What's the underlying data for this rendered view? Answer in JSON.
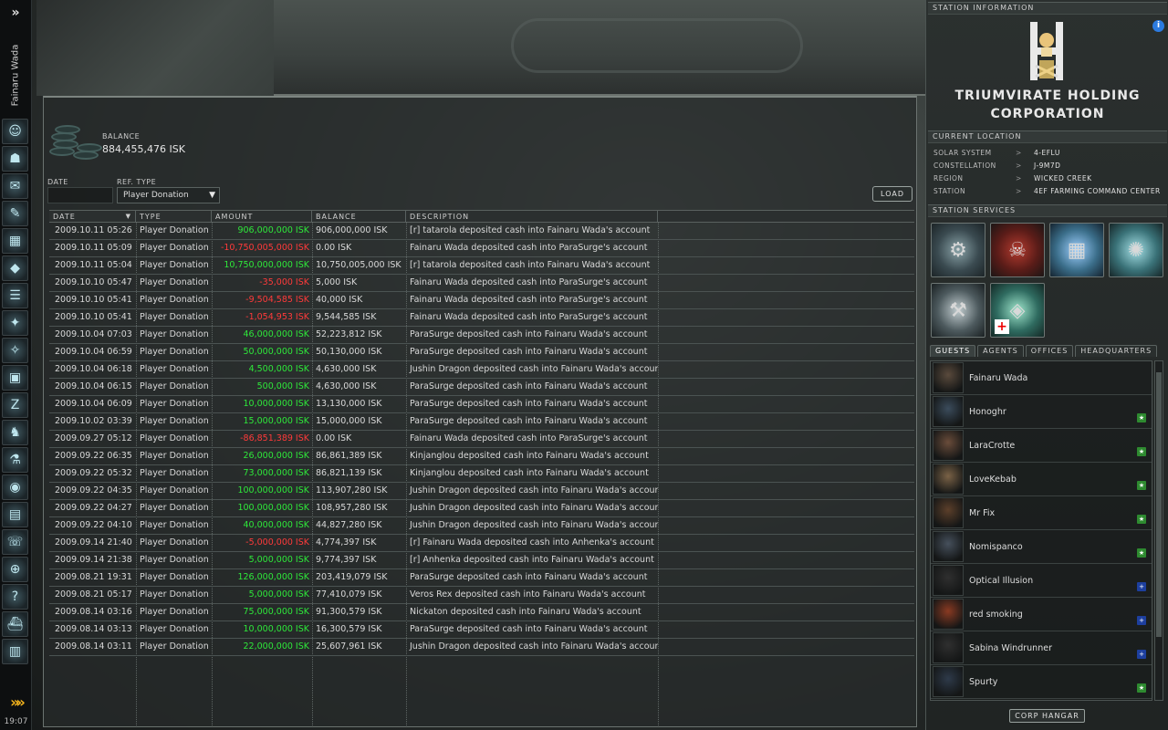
{
  "neocom": {
    "toggle": "»",
    "character_name": "Fainaru Wada",
    "icons": [
      "character-sheet-icon",
      "people-places-icon",
      "mail-icon",
      "notepad-icon",
      "assets-icon",
      "wallet-icon",
      "journal-icon",
      "map-icon",
      "starmap-icon",
      "market-icon",
      "skills-icon",
      "fitting-icon",
      "science-icon",
      "corporation-icon",
      "contracts-icon",
      "chat-icon",
      "browser-icon",
      "help-icon",
      "ship-hangar-icon",
      "item-hangar-icon"
    ],
    "glyphs": [
      "☺",
      "☗",
      "✉",
      "✎",
      "▦",
      "◆",
      "☰",
      "✦",
      "✧",
      "▣",
      "Z",
      "♞",
      "⚗",
      "◉",
      "▤",
      "☏",
      "⊕",
      "?",
      "⛴",
      "▥"
    ],
    "arrows": "»»",
    "clock": "19:07"
  },
  "wallet": {
    "balance_label": "BALANCE",
    "balance_value": "884,455,476 ISK",
    "date_label": "DATE",
    "ref_type_label": "REF. TYPE",
    "ref_type_value": "Player Donation",
    "load_label": "LOAD",
    "columns": [
      "DATE",
      "TYPE",
      "AMOUNT",
      "BALANCE",
      "DESCRIPTION"
    ],
    "rows": [
      {
        "date": "2009.10.11 05:26",
        "type": "Player Donation",
        "amount": "906,000,000 ISK",
        "sign": "pos",
        "balance": "906,000,000 ISK",
        "desc": "[r] tatarola deposited cash into Fainaru Wada's account"
      },
      {
        "date": "2009.10.11 05:09",
        "type": "Player Donation",
        "amount": "-10,750,005,000 ISK",
        "sign": "neg",
        "balance": "0.00 ISK",
        "desc": "Fainaru Wada deposited cash into ParaSurge's account"
      },
      {
        "date": "2009.10.11 05:04",
        "type": "Player Donation",
        "amount": "10,750,000,000 ISK",
        "sign": "pos",
        "balance": "10,750,005,000 ISK",
        "desc": "[r] tatarola deposited cash into Fainaru Wada's account"
      },
      {
        "date": "2009.10.10 05:47",
        "type": "Player Donation",
        "amount": "-35,000 ISK",
        "sign": "neg",
        "balance": "5,000 ISK",
        "desc": "Fainaru Wada deposited cash into ParaSurge's account"
      },
      {
        "date": "2009.10.10 05:41",
        "type": "Player Donation",
        "amount": "-9,504,585 ISK",
        "sign": "neg",
        "balance": "40,000 ISK",
        "desc": "Fainaru Wada deposited cash into ParaSurge's account"
      },
      {
        "date": "2009.10.10 05:41",
        "type": "Player Donation",
        "amount": "-1,054,953 ISK",
        "sign": "neg",
        "balance": "9,544,585 ISK",
        "desc": "Fainaru Wada deposited cash into ParaSurge's account"
      },
      {
        "date": "2009.10.04 07:03",
        "type": "Player Donation",
        "amount": "46,000,000 ISK",
        "sign": "pos",
        "balance": "52,223,812 ISK",
        "desc": "ParaSurge deposited cash into Fainaru Wada's account"
      },
      {
        "date": "2009.10.04 06:59",
        "type": "Player Donation",
        "amount": "50,000,000 ISK",
        "sign": "pos",
        "balance": "50,130,000 ISK",
        "desc": "ParaSurge deposited cash into Fainaru Wada's account"
      },
      {
        "date": "2009.10.04 06:18",
        "type": "Player Donation",
        "amount": "4,500,000 ISK",
        "sign": "pos",
        "balance": "4,630,000 ISK",
        "desc": "Jushin Dragon deposited cash into Fainaru Wada's account"
      },
      {
        "date": "2009.10.04 06:15",
        "type": "Player Donation",
        "amount": "500,000 ISK",
        "sign": "pos",
        "balance": "4,630,000 ISK",
        "desc": "ParaSurge deposited cash into Fainaru Wada's account"
      },
      {
        "date": "2009.10.04 06:09",
        "type": "Player Donation",
        "amount": "10,000,000 ISK",
        "sign": "pos",
        "balance": "13,130,000 ISK",
        "desc": "ParaSurge deposited cash into Fainaru Wada's account"
      },
      {
        "date": "2009.10.02 03:39",
        "type": "Player Donation",
        "amount": "15,000,000 ISK",
        "sign": "pos",
        "balance": "15,000,000 ISK",
        "desc": "ParaSurge deposited cash into Fainaru Wada's account"
      },
      {
        "date": "2009.09.27 05:12",
        "type": "Player Donation",
        "amount": "-86,851,389 ISK",
        "sign": "neg",
        "balance": "0.00 ISK",
        "desc": "Fainaru Wada deposited cash into ParaSurge's account"
      },
      {
        "date": "2009.09.22 06:35",
        "type": "Player Donation",
        "amount": "26,000,000 ISK",
        "sign": "pos",
        "balance": "86,861,389 ISK",
        "desc": "Kinjanglou deposited cash into Fainaru Wada's account"
      },
      {
        "date": "2009.09.22 05:32",
        "type": "Player Donation",
        "amount": "73,000,000 ISK",
        "sign": "pos",
        "balance": "86,821,139 ISK",
        "desc": "Kinjanglou deposited cash into Fainaru Wada's account"
      },
      {
        "date": "2009.09.22 04:35",
        "type": "Player Donation",
        "amount": "100,000,000 ISK",
        "sign": "pos",
        "balance": "113,907,280 ISK",
        "desc": "Jushin Dragon deposited cash into Fainaru Wada's account"
      },
      {
        "date": "2009.09.22 04:27",
        "type": "Player Donation",
        "amount": "100,000,000 ISK",
        "sign": "pos",
        "balance": "108,957,280 ISK",
        "desc": "Jushin Dragon deposited cash into Fainaru Wada's account"
      },
      {
        "date": "2009.09.22 04:10",
        "type": "Player Donation",
        "amount": "40,000,000 ISK",
        "sign": "pos",
        "balance": "44,827,280 ISK",
        "desc": "Jushin Dragon deposited cash into Fainaru Wada's account"
      },
      {
        "date": "2009.09.14 21:40",
        "type": "Player Donation",
        "amount": "-5,000,000 ISK",
        "sign": "neg",
        "balance": "4,774,397 ISK",
        "desc": "[r] Fainaru Wada deposited cash into Anhenka's account"
      },
      {
        "date": "2009.09.14 21:38",
        "type": "Player Donation",
        "amount": "5,000,000 ISK",
        "sign": "pos",
        "balance": "9,774,397 ISK",
        "desc": "[r] Anhenka deposited cash into Fainaru Wada's account"
      },
      {
        "date": "2009.08.21 19:31",
        "type": "Player Donation",
        "amount": "126,000,000 ISK",
        "sign": "pos",
        "balance": "203,419,079 ISK",
        "desc": "ParaSurge deposited cash into Fainaru Wada's account"
      },
      {
        "date": "2009.08.21 05:17",
        "type": "Player Donation",
        "amount": "5,000,000 ISK",
        "sign": "pos",
        "balance": "77,410,079 ISK",
        "desc": "Veros Rex deposited cash into Fainaru Wada's account"
      },
      {
        "date": "2009.08.14 03:16",
        "type": "Player Donation",
        "amount": "75,000,000 ISK",
        "sign": "pos",
        "balance": "91,300,579 ISK",
        "desc": "Nickaton deposited cash into Fainaru Wada's account"
      },
      {
        "date": "2009.08.14 03:13",
        "type": "Player Donation",
        "amount": "10,000,000 ISK",
        "sign": "pos",
        "balance": "16,300,579 ISK",
        "desc": "ParaSurge deposited cash into Fainaru Wada's account"
      },
      {
        "date": "2009.08.14 03:11",
        "type": "Player Donation",
        "amount": "22,000,000 ISK",
        "sign": "pos",
        "balance": "25,607,961 ISK",
        "desc": "Jushin Dragon deposited cash into Fainaru Wada's account"
      }
    ]
  },
  "station": {
    "header": "STATION INFORMATION",
    "corp_name_line1": "TRIUMVIRATE HOLDING",
    "corp_name_line2": "CORPORATION",
    "location_header": "CURRENT LOCATION",
    "location": [
      {
        "k": "SOLAR SYSTEM",
        "v": "4-EFLU"
      },
      {
        "k": "CONSTELLATION",
        "v": "J-9M7D"
      },
      {
        "k": "REGION",
        "v": "WICKED CREEK"
      },
      {
        "k": "STATION",
        "v": "4EF FARMING COMMAND CENTER"
      }
    ],
    "loc_sep": ">",
    "services_header": "STATION SERVICES",
    "services": [
      "repair-shop-service",
      "clone-bay-service",
      "fitting-service",
      "reprocessing-service",
      "cloning-service",
      "medical-service"
    ],
    "tabs": [
      "GUESTS",
      "AGENTS",
      "OFFICES",
      "HEADQUARTERS"
    ],
    "guests": [
      {
        "name": "Fainaru Wada",
        "standing": ""
      },
      {
        "name": "Honoghr",
        "standing": "green"
      },
      {
        "name": "LaraCrotte",
        "standing": "green"
      },
      {
        "name": "LoveKebab",
        "standing": "green"
      },
      {
        "name": "Mr Fix",
        "standing": "green"
      },
      {
        "name": "Nomispanco",
        "standing": "green"
      },
      {
        "name": "Optical Illusion",
        "standing": "blue"
      },
      {
        "name": "red smoking",
        "standing": "blue"
      },
      {
        "name": "Sabina Windrunner",
        "standing": "blue"
      },
      {
        "name": "Spurty",
        "standing": "green"
      }
    ],
    "corp_hangar_label": "CORP HANGAR",
    "info_label": "i"
  }
}
